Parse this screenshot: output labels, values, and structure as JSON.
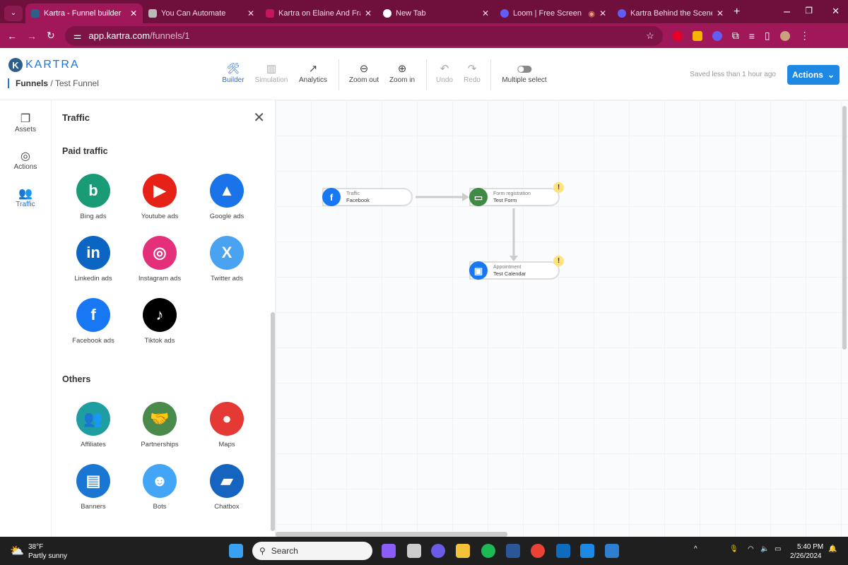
{
  "browser": {
    "tabs": [
      {
        "title": "Kartra - Funnel builder",
        "active": true,
        "color": "#2c5f8a"
      },
      {
        "title": "You Can Automate",
        "color": "#bbbbbb"
      },
      {
        "title": "Kartra on Elaine And Fran",
        "color": "#c2185b"
      },
      {
        "title": "New Tab",
        "color": "#ffffff"
      },
      {
        "title": "Loom | Free Screen &",
        "color": "#625df5"
      },
      {
        "title": "Kartra Behind the Scenes",
        "color": "#625df5"
      }
    ],
    "url_host": "app.kartra.com",
    "url_path": "/funnels/1"
  },
  "header": {
    "logo": "KARTRA",
    "breadcrumb_root": "Funnels",
    "breadcrumb_sep": "/",
    "breadcrumb_current": "Test Funnel",
    "tools": [
      {
        "label": "Builder",
        "icon": "🛠"
      },
      {
        "label": "Simulation",
        "icon": "▥"
      },
      {
        "label": "Analytics",
        "icon": "↗"
      },
      {
        "label": "Zoom out",
        "icon": "⊖"
      },
      {
        "label": "Zoom in",
        "icon": "⊕"
      },
      {
        "label": "Undo",
        "icon": "↶"
      },
      {
        "label": "Redo",
        "icon": "↷"
      },
      {
        "label": "Multiple select"
      }
    ],
    "saved": "Saved less than 1 hour ago",
    "actions": "Actions"
  },
  "rail": [
    {
      "label": "Assets",
      "icon": "❐"
    },
    {
      "label": "Actions",
      "icon": "◎"
    },
    {
      "label": "Traffic",
      "icon": "👥"
    }
  ],
  "panel": {
    "title": "Traffic",
    "paid_heading": "Paid traffic",
    "others_heading": "Others",
    "paid": [
      {
        "label": "Bing ads",
        "glyph": "b",
        "color": "#1a9b78"
      },
      {
        "label": "Youtube ads",
        "glyph": "▶",
        "color": "#e62117"
      },
      {
        "label": "Google ads",
        "glyph": "▲",
        "color": "#1a73e8"
      },
      {
        "label": "Linkedin ads",
        "glyph": "in",
        "color": "#0a66c2"
      },
      {
        "label": "Instagram ads",
        "glyph": "◎",
        "color": "#e4307a"
      },
      {
        "label": "Twitter ads",
        "glyph": "X",
        "color": "#4aa3f0"
      },
      {
        "label": "Facebook ads",
        "glyph": "f",
        "color": "#1877f2"
      },
      {
        "label": "Tiktok ads",
        "glyph": "♪",
        "color": "#000000"
      }
    ],
    "others": [
      {
        "label": "Affiliates",
        "glyph": "👥",
        "color": "#1e9ea0"
      },
      {
        "label": "Partnerships",
        "glyph": "🤝",
        "color": "#4a8a4a"
      },
      {
        "label": "Maps",
        "glyph": "●",
        "color": "#e53935"
      },
      {
        "label": "Banners",
        "glyph": "▤",
        "color": "#1976d2"
      },
      {
        "label": "Bots",
        "glyph": "☻",
        "color": "#42a5f5"
      },
      {
        "label": "Chatbox",
        "glyph": "▰",
        "color": "#1565c0"
      }
    ]
  },
  "canvas": {
    "nodes": [
      {
        "type": "Traffic",
        "name": "Facebook",
        "glyph": "f",
        "color": "#1877f2"
      },
      {
        "type": "Form registration",
        "name": "Test Form",
        "glyph": "▭",
        "color": "#3f8a45",
        "warning": "!"
      },
      {
        "type": "Appointment",
        "name": "Test Calendar",
        "glyph": "▣",
        "color": "#1877f2",
        "warning": "!"
      }
    ]
  },
  "taskbar": {
    "temp": "38°F",
    "weather": "Partly sunny",
    "search": "Search",
    "time": "5:40 PM",
    "date": "2/26/2024"
  }
}
